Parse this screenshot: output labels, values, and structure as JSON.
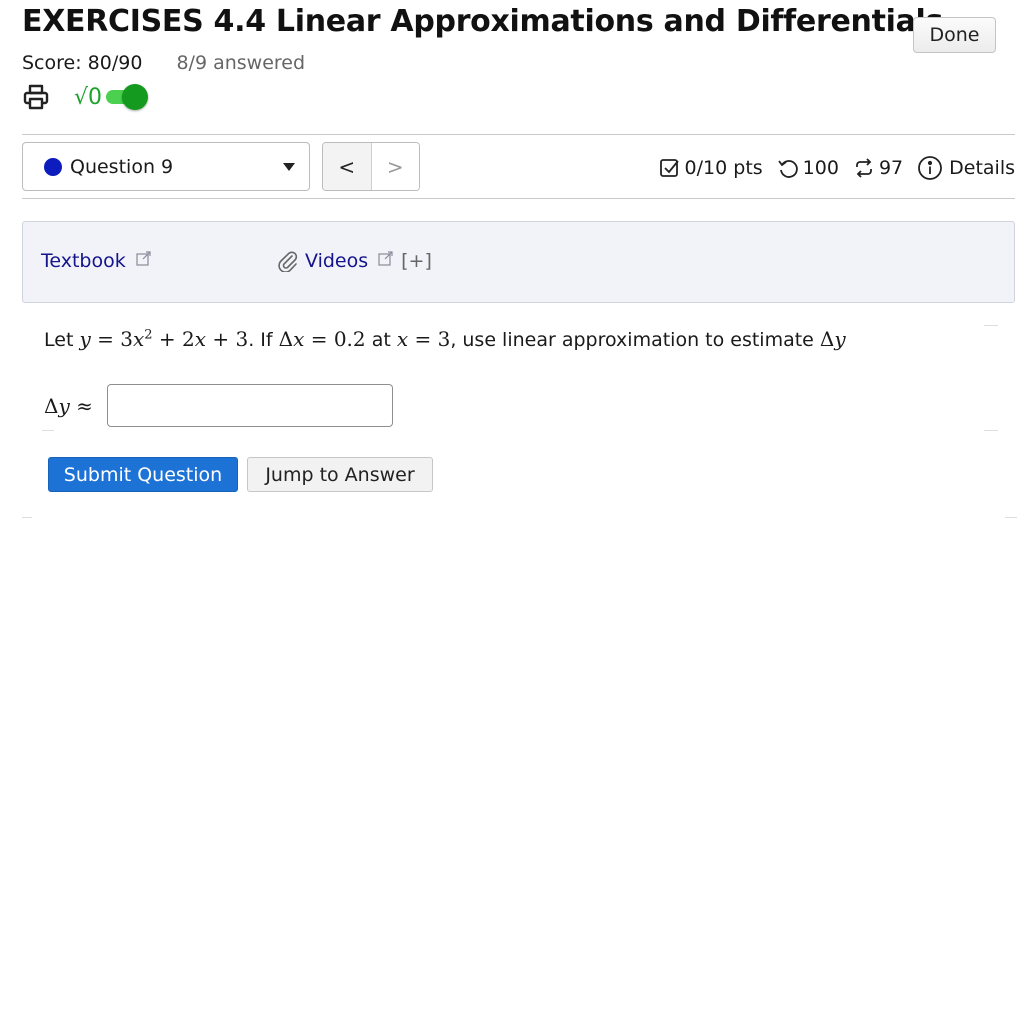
{
  "header": {
    "title": "EXERCISES 4.4 Linear Approximations and Differentials",
    "done_label": "Done",
    "score": "Score: 80/90",
    "answered": "8/9 answered"
  },
  "toolbar": {
    "print_icon": "printer-icon",
    "math_toggle_label": "√0",
    "math_toggle_on": true
  },
  "question_nav": {
    "selected": "Question 9",
    "prev_label": "<",
    "next_label": ">"
  },
  "meta": {
    "points": "0/10 pts",
    "retries": "100",
    "attempts": "97",
    "details_label": "Details"
  },
  "resources": {
    "textbook_label": "Textbook",
    "videos_label": "Videos",
    "expand_label": "[+]"
  },
  "question": {
    "prefix": "Let",
    "conjunction": ". If",
    "at": "at",
    "instruction": ", use linear approximation to estimate",
    "answer_value": ""
  },
  "actions": {
    "submit_label": "Submit Question",
    "jump_label": "Jump to Answer"
  },
  "colors": {
    "primary": "#1d72d6",
    "link": "#14148c",
    "toggle_green": "#139a1f",
    "question_dot": "#0d1dbd"
  }
}
